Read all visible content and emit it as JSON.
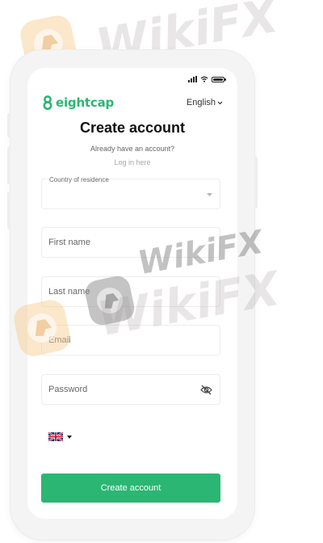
{
  "brand": {
    "name": "eightcap",
    "color": "#2bb673"
  },
  "language": {
    "selected": "English",
    "chevron": "chevron-down-icon"
  },
  "page": {
    "title": "Create account",
    "subtitle": "Already have an account?",
    "login_link": "Log in here"
  },
  "form": {
    "country": {
      "label": "Country of residence",
      "value": ""
    },
    "first_name": {
      "placeholder": "First name"
    },
    "last_name": {
      "placeholder": "Last name"
    },
    "email": {
      "placeholder": "Email"
    },
    "password": {
      "placeholder": "Password",
      "toggle_icon": "eye-off-icon"
    },
    "phone": {
      "country_flag": "uk-flag-icon"
    },
    "submit_label": "Create account"
  },
  "watermark": {
    "text": "WikiFX",
    "icon": "wikifx-logo-icon"
  },
  "colors": {
    "accent": "#2bb673",
    "watermark_orange": "#f6c98a",
    "watermark_gray": "#9a9090"
  }
}
